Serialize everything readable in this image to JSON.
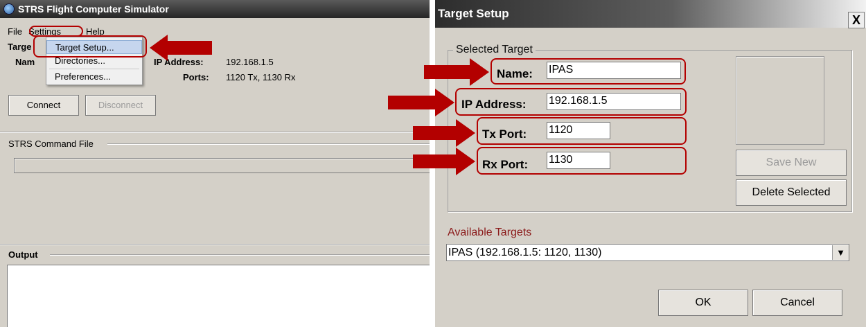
{
  "left_window": {
    "title": "STRS Flight Computer Simulator",
    "menu": {
      "file": "File",
      "settings": "Settings",
      "help": "Help"
    },
    "settings_menu": [
      "Target Setup...",
      "Directories...",
      "Preferences..."
    ],
    "target": {
      "group_label": "Targe",
      "name_label": "Nam",
      "ip_label": "IP Address:",
      "ip_value": "192.168.1.5",
      "ports_label": "Ports:",
      "ports_value": "1120 Tx, 1130 Rx"
    },
    "connect_label": "Connect",
    "disconnect_label": "Disconnect",
    "command_file_label": "STRS Command File",
    "output_label": "Output"
  },
  "dialog": {
    "title": "Target Setup",
    "close_label": "X",
    "selected_target_label": "Selected Target",
    "name_label": "Name:",
    "name_value": "IPAS",
    "ip_label": "IP Address:",
    "ip_value": "192.168.1.5",
    "tx_label": "Tx Port:",
    "tx_value": "1120",
    "rx_label": "Rx Port:",
    "rx_value": "1130",
    "save_new_label": "Save New",
    "delete_label": "Delete Selected",
    "available_label": "Available Targets",
    "available_selected": "IPAS (192.168.1.5: 1120, 1130)",
    "ok_label": "OK",
    "cancel_label": "Cancel"
  },
  "colors": {
    "annotation": "#b30000",
    "available_label": "#8b1a1a",
    "menu_highlight": "#c6d6ee"
  },
  "icons": [
    "app-icon",
    "dropdown-arrow-icon",
    "close-icon",
    "annotation-arrow"
  ]
}
